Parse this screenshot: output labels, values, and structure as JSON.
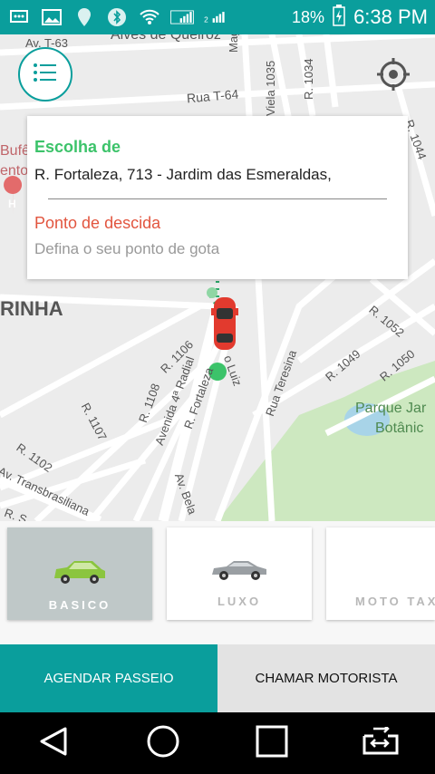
{
  "status_bar": {
    "battery": "18%",
    "time": "6:38 PM",
    "icons": [
      "message-icon",
      "image-icon",
      "location-icon",
      "bluetooth-icon",
      "wifi-icon",
      "signal-1-icon",
      "signal-2-icon",
      "battery-icon"
    ]
  },
  "map": {
    "labels": {
      "alves": "Alves de Queiroz",
      "t63": "Av. T-63",
      "t64": "Rua T-64",
      "magalhaes": "Magalhães",
      "viela": "Viela 1035",
      "r1034": "R. 1034",
      "r1044": "R. 1044",
      "bufe": "Bufê",
      "ento": "ento",
      "rinha": "RINHA",
      "r1106": "R. 1106",
      "r1052": "R. 1052",
      "r1049": "R. 1049",
      "r1050": "R. 1050",
      "r1108": "R. 1108",
      "r1107": "R. 1107",
      "avenida4": "Avenida 4ª Radial",
      "rfortaleza": "R. Fortaleza",
      "luiz": "o Luiz",
      "teresina": "Rua Teresina",
      "parque": "Parque Jar",
      "botanic": "Botânic",
      "r1102": "R. 1102",
      "transbrasiliana": "Av. Transbrasiliana",
      "avbela": "Av. Bela",
      "rs": "R. S"
    }
  },
  "trip_card": {
    "pickup_title": "Escolha de",
    "pickup_address": "R. Fortaleza, 713 - Jardim das Esmeraldas,",
    "dropoff_title": "Ponto de descida",
    "dropoff_placeholder": "Defina o seu ponto de gota"
  },
  "vehicles": [
    {
      "label": "BASICO",
      "selected": true,
      "color": "#8bc53f"
    },
    {
      "label": "LUXO",
      "selected": false,
      "color": "#9a9fa3"
    },
    {
      "label": "MOTO TAX",
      "selected": false,
      "color": "#ffffff"
    }
  ],
  "actions": {
    "schedule": "AGENDAR PASSEIO",
    "call_driver": "CHAMAR MOTORISTA"
  },
  "colors": {
    "primary": "#0a9e9c",
    "pickup": "#3cc36a",
    "dropoff": "#e2553f"
  }
}
